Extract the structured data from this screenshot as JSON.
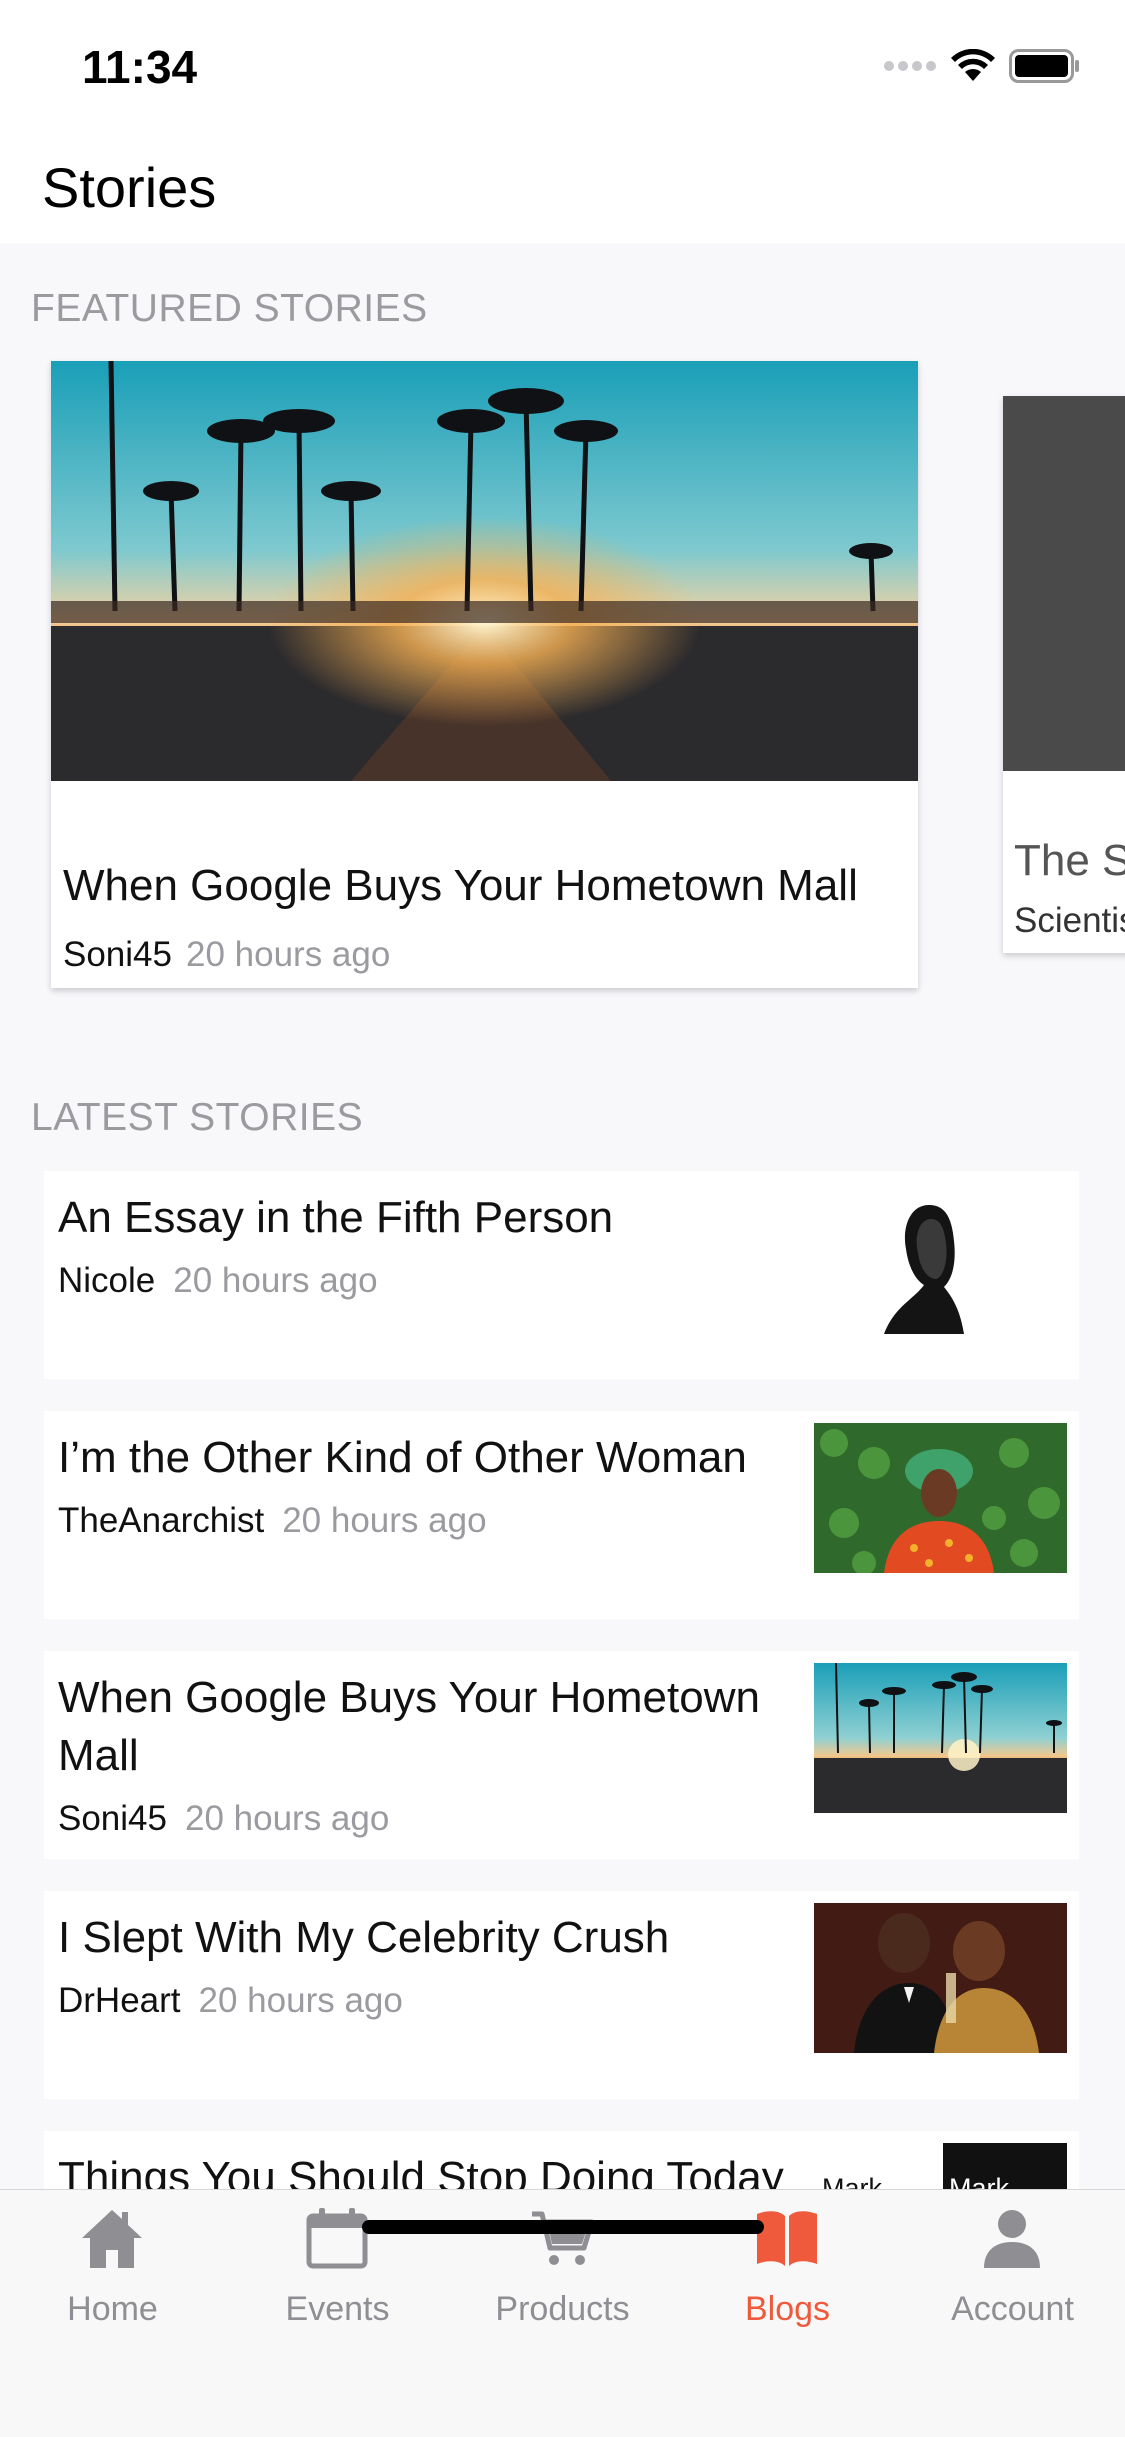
{
  "status_bar": {
    "time": "11:34"
  },
  "header": {
    "title": "Stories"
  },
  "featured": {
    "section_label": "FEATURED STORIES",
    "cards": [
      {
        "title": "When Google Buys Your Hometown Mall",
        "author": "Soni45",
        "time": "20 hours ago"
      },
      {
        "title": "The Sc",
        "author": "Scientis",
        "time": ""
      }
    ]
  },
  "latest": {
    "section_label": "LATEST STORIES",
    "items": [
      {
        "title": "An Essay in the Fifth Person",
        "author": "Nicole",
        "time": "20 hours ago"
      },
      {
        "title": "I’m the Other Kind of Other Woman",
        "author": "TheAnarchist",
        "time": "20 hours ago"
      },
      {
        "title": "When Google Buys Your Hometown Mall",
        "author": "Soni45",
        "time": "20 hours ago"
      },
      {
        "title": "I Slept With My Celebrity Crush",
        "author": "DrHeart",
        "time": "20 hours ago"
      },
      {
        "title": "Things You Should Stop Doing Today",
        "author": "Mark",
        "time": "",
        "thumb_text": "Mark"
      }
    ]
  },
  "tabbar": {
    "tabs": [
      {
        "label": "Home",
        "icon": "home-icon",
        "active": false
      },
      {
        "label": "Events",
        "icon": "calendar-icon",
        "active": false
      },
      {
        "label": "Products",
        "icon": "cart-icon",
        "active": false
      },
      {
        "label": "Blogs",
        "icon": "book-icon",
        "active": true
      },
      {
        "label": "Account",
        "icon": "person-icon",
        "active": false
      }
    ],
    "active_color": "#f05a3c",
    "inactive_color": "#8e8e93"
  }
}
